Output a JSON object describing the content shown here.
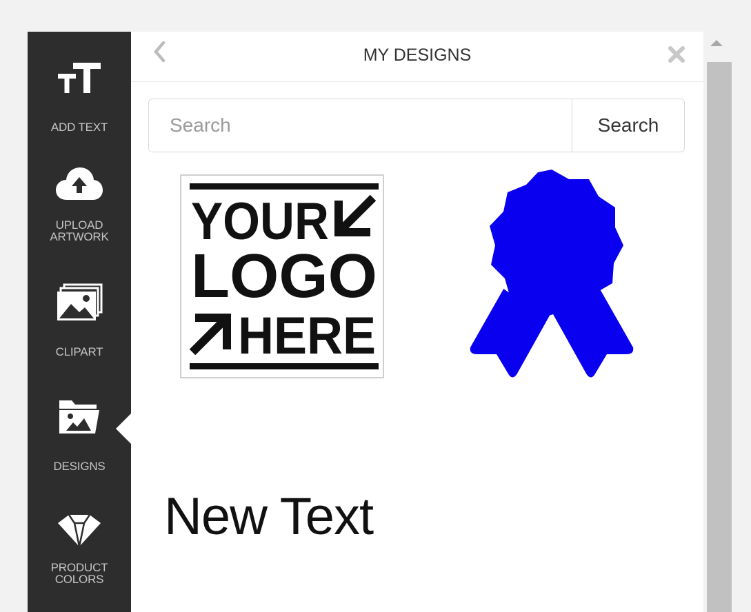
{
  "sidebar": {
    "items": [
      {
        "label": "ADD TEXT",
        "icon": "add-text-icon"
      },
      {
        "label": "UPLOAD ARTWORK",
        "icon": "cloud-upload-icon"
      },
      {
        "label": "CLIPART",
        "icon": "images-icon"
      },
      {
        "label": "DESIGNS",
        "icon": "folder-image-icon",
        "active": true
      },
      {
        "label": "PRODUCT COLORS",
        "icon": "color-swatch-icon"
      }
    ]
  },
  "panel": {
    "title": "MY DESIGNS",
    "back_icon": "chevron-left-icon",
    "close_icon": "close-icon"
  },
  "search": {
    "placeholder": "Search",
    "value": "",
    "button_label": "Search"
  },
  "designs": {
    "logo": {
      "line1": "YOUR",
      "line2": "LOGO",
      "line3": "HERE"
    },
    "ribbon": {
      "icon": "award-ribbon-icon",
      "color": "#0a00f0"
    },
    "text_item": "New Text"
  },
  "colors": {
    "sidebar_bg": "#2d2d2d",
    "panel_bg": "#ffffff",
    "page_bg": "#f2f2f2",
    "scroll_thumb": "#c1c1c1"
  }
}
